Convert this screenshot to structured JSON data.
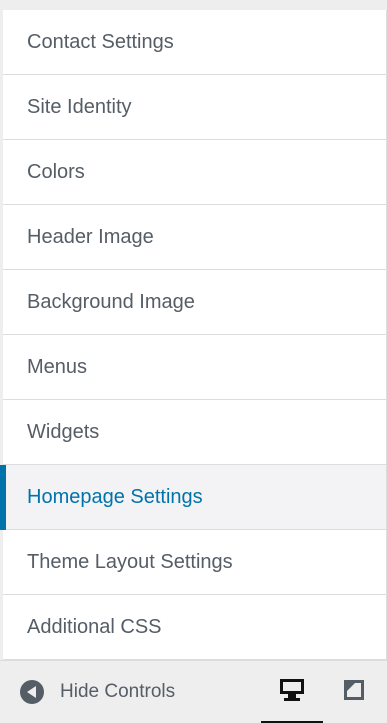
{
  "menu": {
    "items": [
      {
        "label": "Contact Settings",
        "active": false
      },
      {
        "label": "Site Identity",
        "active": false
      },
      {
        "label": "Colors",
        "active": false
      },
      {
        "label": "Header Image",
        "active": false
      },
      {
        "label": "Background Image",
        "active": false
      },
      {
        "label": "Menus",
        "active": false
      },
      {
        "label": "Widgets",
        "active": false
      },
      {
        "label": "Homepage Settings",
        "active": true
      },
      {
        "label": "Theme Layout Settings",
        "active": false
      },
      {
        "label": "Additional CSS",
        "active": false
      }
    ]
  },
  "footer": {
    "hide_controls_label": "Hide Controls",
    "collapse_icon": "arrow-left-circle-icon",
    "devices": [
      {
        "name": "desktop-preview-icon",
        "active": true
      },
      {
        "name": "tablet-preview-icon",
        "active": false
      }
    ]
  },
  "colors": {
    "accent": "#0073aa",
    "text": "#555d66",
    "background": "#eeeeee",
    "active_background": "#f3f3f5",
    "border": "#dddddd"
  }
}
